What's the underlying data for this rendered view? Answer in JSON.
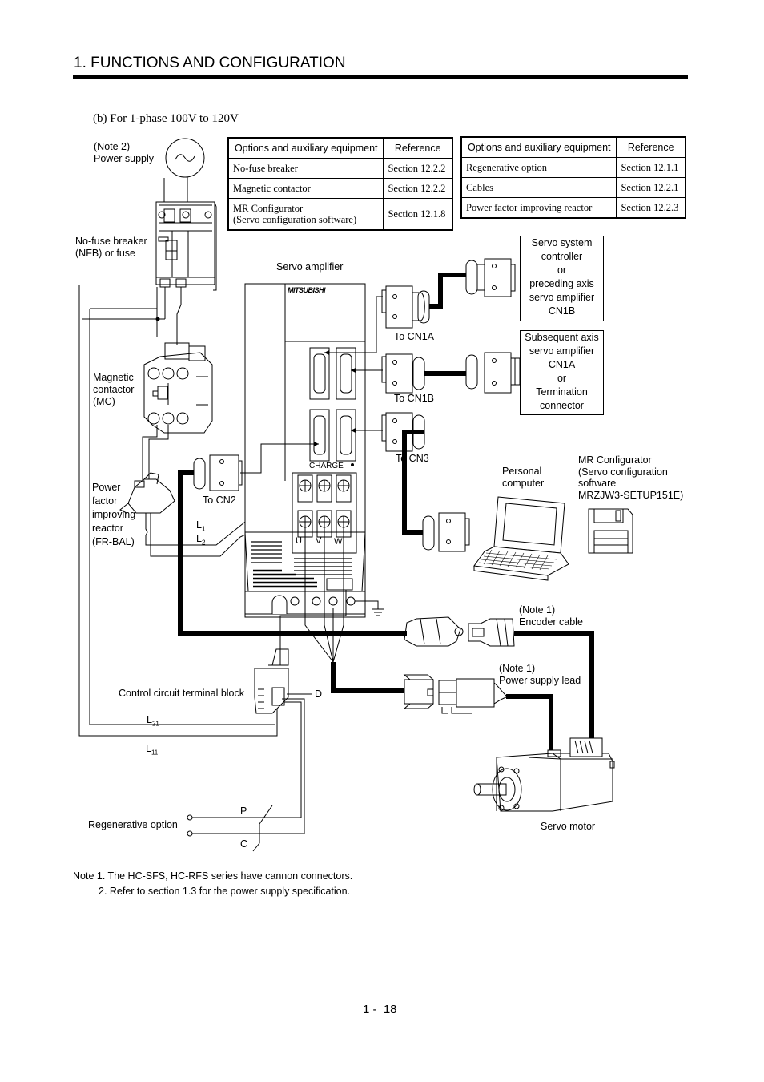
{
  "header": {
    "section_title": "1. FUNCTIONS AND CONFIGURATION",
    "subtitle": "(b) For 1-phase 100V to 120V"
  },
  "tables": [
    {
      "headers": [
        "Options and auxiliary equipment",
        "Reference"
      ],
      "rows": [
        {
          "item": "No-fuse breaker",
          "reference": "Section 12.2.2"
        },
        {
          "item": "Magnetic contactor",
          "reference": "Section 12.2.2"
        },
        {
          "item_line1": "MR Configurator",
          "item_line2": "(Servo configuration software)",
          "reference": "Section 12.1.8"
        }
      ]
    },
    {
      "headers": [
        "Options and auxiliary equipment",
        "Reference"
      ],
      "rows": [
        {
          "item": "Regenerative option",
          "reference": "Section 12.1.1"
        },
        {
          "item": "Cables",
          "reference": "Section 12.2.1"
        },
        {
          "item": "Power factor improving reactor",
          "reference": "Section 12.2.3"
        }
      ]
    }
  ],
  "labels": {
    "power_supply_note": "(Note 2)",
    "power_supply": "Power supply",
    "nfb_line1": "No-fuse breaker",
    "nfb_line2": "(NFB) or fuse",
    "mc_line1": "Magnetic",
    "mc_line2": "contactor",
    "mc_line3": "(MC)",
    "reactor_line1": "Power",
    "reactor_line2": "factor",
    "reactor_line3": "improving",
    "reactor_line4": "reactor",
    "reactor_line5": "(FR-BAL)",
    "servo_amplifier": "Servo amplifier",
    "brand": "MITSUBISHI",
    "charge": "CHARGE",
    "to_cn1a": "To CN1A",
    "to_cn1b": "To CN1B",
    "to_cn3": "To CN3",
    "to_cn2": "To CN2",
    "l1": "L",
    "l1_sub": "1",
    "l2": "L",
    "l2_sub": "2",
    "u": "U",
    "v": "V",
    "w": "W",
    "controller_box": [
      "Servo system",
      "controller",
      "or",
      "preceding axis",
      "servo amplifier",
      "CN1B"
    ],
    "subsequent_box": [
      "Subsequent axis",
      "servo amplifier",
      "CN1A",
      "or",
      "Termination",
      "connector"
    ],
    "personal_computer_line1": "Personal",
    "personal_computer_line2": "computer",
    "mr_config_line1": "MR Configurator",
    "mr_config_line2": "(Servo configuration",
    "mr_config_line3": "software",
    "mr_config_line4": "MRZJW3-SETUP151E)",
    "encoder_note": "(Note 1)",
    "encoder_cable": "Encoder cable",
    "power_lead_note": "(Note 1)",
    "power_lead": "Power supply lead",
    "control_block": "Control circuit terminal block",
    "d": "D",
    "l21": "L",
    "l21_sub": "21",
    "l11": "L",
    "l11_sub": "11",
    "p": "P",
    "c": "C",
    "regen_option": "Regenerative option",
    "servo_motor": "Servo motor"
  },
  "notes": [
    "Note 1. The HC-SFS, HC-RFS series have cannon connectors.",
    "2. Refer to section 1.3 for the power supply specification."
  ],
  "footer": {
    "page_number": "1 -  18"
  }
}
